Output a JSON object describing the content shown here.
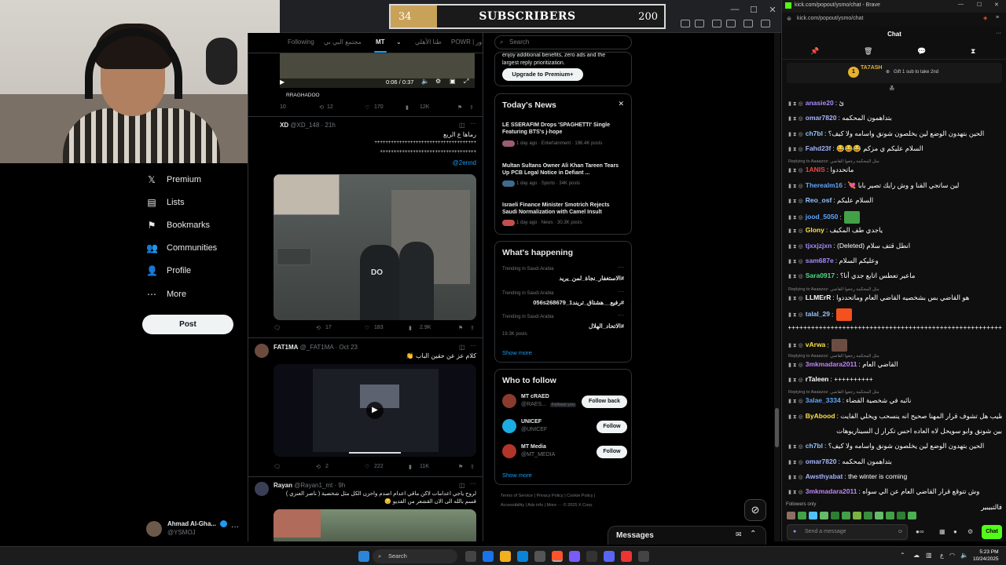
{
  "overlay": {
    "subs_current": "34",
    "subs_title": "SUBSCRIBERS",
    "subs_goal": "200",
    "subs_progress_fraction": 0.17
  },
  "x_sidebar": {
    "items": [
      {
        "label": "Premium",
        "icon": "x-logo-icon"
      },
      {
        "label": "Lists",
        "icon": "list-icon"
      },
      {
        "label": "Bookmarks",
        "icon": "bookmark-icon"
      },
      {
        "label": "Communities",
        "icon": "communities-icon"
      },
      {
        "label": "Profile",
        "icon": "profile-icon"
      },
      {
        "label": "More",
        "icon": "more-icon"
      }
    ],
    "post_label": "Post",
    "account": {
      "name": "Ahmad Al-Gha...",
      "handle": "@YSMOJ"
    }
  },
  "feed": {
    "tabs": [
      "Following",
      "مجتمع البي بي",
      "MT",
      "طنا الأهلي",
      "POWR | ياور"
    ],
    "video_time": "0:06 / 0:37",
    "post0": {
      "user": "RRAGHADOO",
      "replies": "10",
      "reposts": "12",
      "likes": "170",
      "views": "12K"
    },
    "post1": {
      "name": "XD",
      "handle": "@XD_148 · 21h",
      "line1": "رماها ع الربع",
      "line2": "+++++++++++++++++++++++++++++++++++++",
      "line3": "+++++++++++++++++++++++++++++++++++",
      "mention": "@2ennd",
      "reposts": "17",
      "likes": "183",
      "views": "2.9K",
      "screen_text": "DO"
    },
    "post2": {
      "name": "FAT1MA",
      "handle": "@_FAT1MA · Oct 23",
      "text": "كلام عز عن حقين الباب 👏",
      "reposts": "2",
      "likes": "222",
      "views": "11K"
    },
    "post3": {
      "name": "Rayan",
      "handle": "@Rayan1_mt · 9h",
      "line1": "لروح ياجي اعدامات لاكن ماقي اعدام اصدم واحزن الكل مثل شخصية ( ناصر العنزي )",
      "line2": "قسم بالله الى الان القشعر من الفديو 😔"
    }
  },
  "right": {
    "search_placeholder": "Search",
    "premium_text1": "enjoy additional benefits, zero ads and the",
    "premium_text2": "largest reply prioritization.",
    "premium_btn": "Upgrade to Premium+",
    "news_title": "Today's News",
    "news": [
      {
        "title": "LE SSERAFIM Drops 'SPAGHETTI' Single Featuring BTS's j-hope",
        "meta": "1 day ago · Entertainment · 196.4K posts"
      },
      {
        "title": "Multan Sultans Owner Ali Khan Tareen Tears Up PCB Legal Notice in Defiant ...",
        "meta": "1 day ago · Sports · 34K posts"
      },
      {
        "title": "Israeli Finance Minister Smotrich Rejects Saudi Normalization with Camel Insult",
        "meta": "1 day ago · News · 30.3K posts"
      }
    ],
    "happening_title": "What's happening",
    "trends": [
      {
        "kicker": "Trending in Saudi Arabia",
        "value": "#الاستغفار_نجاة_لمن_يريد",
        "detail": ""
      },
      {
        "kicker": "Trending in Saudi Arabia",
        "value": "#رفيع__هشتاق_تريند1_056s268679",
        "detail": ""
      },
      {
        "kicker": "Trending in Saudi Arabia",
        "value": "#الاتحاد_الهلال",
        "detail": "19.3K posts"
      }
    ],
    "show_more": "Show more",
    "wtf_title": "Who to follow",
    "wtf": [
      {
        "name": "MT cRAED",
        "handle": "@RAES...",
        "badge": "Follows you",
        "button": "Follow back"
      },
      {
        "name": "UNICEF",
        "handle": "@UNICEF",
        "badge": "",
        "button": "Follow"
      },
      {
        "name": "MT Media",
        "handle": "@MT_MEDIA",
        "badge": "",
        "button": "Follow"
      }
    ],
    "footer1": "Terms of Service  |  Privacy Policy  |  Cookie Policy  |",
    "footer2": "Accessibility  |  Ads info  |  More ···  © 2025 X Corp.",
    "messages": "Messages"
  },
  "kick": {
    "window_title": "kick.com/popout/ysmo/chat - Brave",
    "url": "kick.com/popout/ysmo/chat",
    "chat_title": "Chat",
    "pinned_user": "TA7ASH",
    "pinned_text": "Gift 1 sub to take 2nd",
    "messages": [
      {
        "user": "anasie20",
        "text": "ئ",
        "color": "#a78bfa"
      },
      {
        "user": "omar7820",
        "text": "بتداهمون المحكمه",
        "color": "#a5b4fc"
      },
      {
        "user": "ch7bl",
        "text": "الحين بتهدون الوضع لين يخلصون شونق واسامه ولا كيف؟",
        "color": "#93c5fd"
      },
      {
        "user": "Fahd23f",
        "text": "السلام عليكم ي مزكم 😂😂😂",
        "color": "#a5b4fc"
      },
      {
        "user": "1ANIS",
        "text": "ماتحددوا",
        "color": "#ef4444",
        "reply": "Replying to Aaaazoz: مثل المحكمة رجعوا القاضي"
      },
      {
        "user": "Therealm16",
        "text": "لين ساتجي القنا و وش رايك تصير بابا 💘",
        "color": "#60a5fa"
      },
      {
        "user": "Reo_osf",
        "text": "السلام عليكم",
        "color": "#93c5fd"
      },
      {
        "user": "jood_5050",
        "text": "",
        "color": "#60a5fa"
      },
      {
        "user": "Glony",
        "text": "ياجدي طف المكيف",
        "color": "#fde047"
      },
      {
        "user": "tjxxjzjxn",
        "text": "انطل قتف سلام (Deleted)",
        "color": "#a78bfa"
      },
      {
        "user": "sam687e",
        "text": "وعليكم السلام",
        "color": "#a78bfa"
      },
      {
        "user": "Sara0917",
        "text": "ماعير تعطس اتابع جدي أنا؟",
        "color": "#4ade80"
      },
      {
        "user": "LLMErR",
        "text": "هو القاضي بس بشخصيه القاضي العام وماتحددوا",
        "color": "#fff",
        "reply": "Replying to Aaaazoz: مثل المحكمة رجعوا القاضي"
      },
      {
        "user": "talal_29",
        "text": "",
        "color": "#93c5fd"
      },
      {
        "user": "",
        "text": "+++++++++++++++++++++++++++++++++++++++++++++++++++++++++++",
        "color": "#fff"
      },
      {
        "user": "vArwa",
        "text": "",
        "color": "#fde047"
      },
      {
        "user": "3mkmadara2011",
        "text": "القاضي العام",
        "color": "#c084fc",
        "reply": "Replying to Aaaazoz: مثل المحكمة رجعوا القاضي"
      },
      {
        "user": "rTaleen",
        "text": "++++++++++",
        "color": "#fff"
      },
      {
        "user": "3alae_3334",
        "text": "نائبه في شخصية القضاء",
        "color": "#60a5fa",
        "reply": "Replying to Aaaazoz: مثل المحكمة رجعوا القاضي"
      },
      {
        "user": "ByAbood",
        "text": "طيب هل تشوف قرار المهنا صحيح انه ينسحب ويخلي الفايت",
        "color": "#fde047"
      },
      {
        "user": "",
        "text": "بين شونق وابو سويحل لاه العاده احس تكرار ل السيناريوهات",
        "color": "#fff"
      },
      {
        "user": "ch7bl",
        "text": "الحين بتهدون الوضع لين يخلصون شونق واسامه ولا كيف؟",
        "color": "#93c5fd"
      },
      {
        "user": "omar7820",
        "text": "بتداهمون المحكمه",
        "color": "#a5b4fc"
      },
      {
        "user": "Awsthyabat",
        "text": "the winter is coming",
        "color": "#a5b4fc"
      },
      {
        "user": "3mkmadara2011",
        "text": "وش تتوقع قرار القاضي العام عن الي سواه",
        "color": "#c084fc"
      },
      {
        "user": "",
        "text": "فالتبيبير",
        "color": "#fff"
      }
    ],
    "followers_only": "Followers only",
    "send_placeholder": "Send a message",
    "chat_button": "Chat"
  },
  "taskbar": {
    "search": "Search",
    "time": "5:23 PM",
    "date": "10/24/2025"
  }
}
